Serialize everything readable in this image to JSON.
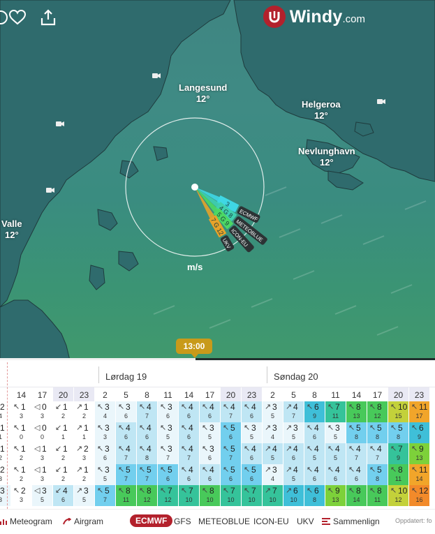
{
  "brand": {
    "name": "Windy",
    "domain": ".com"
  },
  "places": [
    {
      "name": "Langesund",
      "temp": "12°"
    },
    {
      "name": "Helgeroa",
      "temp": "12°"
    },
    {
      "name": "Nevlunghavn",
      "temp": "12°"
    },
    {
      "name": "Valle",
      "temp": "12°"
    }
  ],
  "wind_picker": {
    "unit": "m/s",
    "models": [
      {
        "name": "ECMWF",
        "speed": "3",
        "color": "#3fd7e4"
      },
      {
        "name": "METEOBLUE",
        "speed": "4 G 8",
        "color": "#3fd0b0"
      },
      {
        "name": "ICON-EU",
        "speed": "5 G 9",
        "color": "#4cd864"
      },
      {
        "name": "UKV",
        "speed": "7 G 12",
        "color": "#e6a32a"
      }
    ]
  },
  "timeline": {
    "current_time": "13:00",
    "progress": 0.45
  },
  "days": [
    "Lørdag 19",
    "Søndag 20"
  ],
  "hours": [
    "",
    "14",
    "17",
    "20",
    "23",
    "2",
    "5",
    "8",
    "11",
    "14",
    "17",
    "20",
    "23",
    "2",
    "5",
    "8",
    "11",
    "14",
    "17",
    "20",
    "23"
  ],
  "rows": [
    {
      "speeds": [
        "2",
        "1",
        "0",
        "1",
        "1",
        "3",
        "3",
        "4",
        "3",
        "4",
        "4",
        "4",
        "4",
        "3",
        "4",
        "6",
        "7",
        "8",
        "8",
        "10",
        "11"
      ],
      "gusts": [
        "4",
        "3",
        "3",
        "2",
        "2",
        "4",
        "6",
        "7",
        "6",
        "6",
        "6",
        "7",
        "6",
        "5",
        "7",
        "9",
        "11",
        "13",
        "12",
        "15",
        "17"
      ]
    },
    {
      "speeds": [
        "1",
        "1",
        "0",
        "1",
        "1",
        "3",
        "4",
        "4",
        "3",
        "4",
        "3",
        "5",
        "3",
        "3",
        "3",
        "4",
        "3",
        "5",
        "5",
        "5",
        "6"
      ],
      "gusts": [
        "1",
        "0",
        "0",
        "1",
        "1",
        "3",
        "6",
        "6",
        "5",
        "6",
        "5",
        "6",
        "5",
        "4",
        "5",
        "6",
        "5",
        "8",
        "8",
        "8",
        "9"
      ]
    },
    {
      "speeds": [
        "1",
        "1",
        "1",
        "1",
        "2",
        "3",
        "4",
        "4",
        "3",
        "4",
        "3",
        "5",
        "4",
        "4",
        "4",
        "4",
        "4",
        "4",
        "4",
        "7",
        "9"
      ],
      "gusts": [
        "2",
        "2",
        "3",
        "2",
        "3",
        "6",
        "7",
        "8",
        "7",
        "7",
        "6",
        "7",
        "6",
        "5",
        "6",
        "5",
        "5",
        "7",
        "7",
        "9",
        "13"
      ]
    },
    {
      "speeds": [
        "2",
        "1",
        "1",
        "1",
        "1",
        "3",
        "5",
        "5",
        "5",
        "4",
        "4",
        "5",
        "5",
        "3",
        "4",
        "4",
        "4",
        "4",
        "5",
        "8",
        "11"
      ],
      "gusts": [
        "3",
        "2",
        "3",
        "2",
        "2",
        "5",
        "7",
        "7",
        "6",
        "6",
        "6",
        "6",
        "6",
        "4",
        "5",
        "6",
        "6",
        "6",
        "8",
        "11",
        "14"
      ]
    },
    {
      "speeds": [
        "3",
        "2",
        "3",
        "4",
        "3",
        "5",
        "8",
        "8",
        "7",
        "7",
        "8",
        "7",
        "7",
        "7",
        "6",
        "6",
        "9",
        "8",
        "8",
        "10",
        "12"
      ],
      "gusts": [
        "3",
        "3",
        "5",
        "6",
        "5",
        "7",
        "11",
        "12",
        "12",
        "10",
        "10",
        "10",
        "10",
        "10",
        "10",
        "8",
        "13",
        "14",
        "11",
        "12",
        "16"
      ]
    }
  ],
  "bottom_bar": {
    "meteogram": "Meteogram",
    "airgram": "Airgram",
    "models": [
      "ECMWF",
      "GFS",
      "METEOBLUE",
      "ICON-EU",
      "UKV"
    ],
    "active_model": "ECMWF",
    "compare": "Sammenlign",
    "updated": "Oppdatert: fo"
  },
  "icons": [
    "heart-icon",
    "share-icon",
    "webcam-icon",
    "meteogram-icon",
    "airgram-icon",
    "compare-icon"
  ]
}
